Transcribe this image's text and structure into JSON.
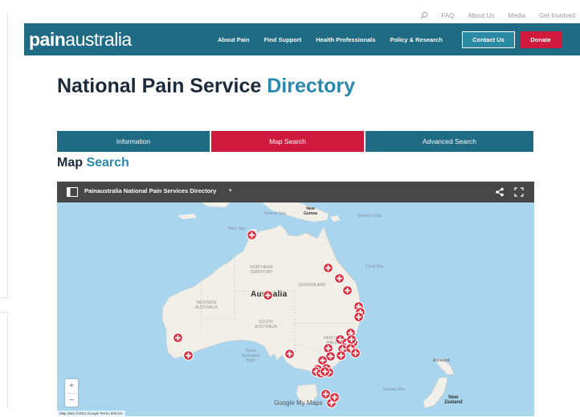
{
  "utility_nav": {
    "links": [
      "FAQ",
      "About Us",
      "Media",
      "Get Involved"
    ]
  },
  "header": {
    "logo": {
      "bold": "pain",
      "light": "australia"
    },
    "nav": [
      "About Pain",
      "Find Support",
      "Health Professionals",
      "Policy & Research"
    ],
    "contact_label": "Contact Us",
    "donate_label": "Donate"
  },
  "page": {
    "title_main": "National Pain Service",
    "title_accent": "Directory"
  },
  "tabs": [
    {
      "label": "Information",
      "active": false
    },
    {
      "label": "Map Search",
      "active": true
    },
    {
      "label": "Advanced Search",
      "active": false
    }
  ],
  "section": {
    "title_main": "Map",
    "title_accent": "Search"
  },
  "map": {
    "title": "Painaustralia National Pain Services Directory",
    "zoom_in": "+",
    "zoom_out": "−",
    "google_label": "Google My Maps",
    "attribution": "Map data ©2021 Google   Terms   500 km",
    "labels": {
      "new_guinea": "New\nGuinea",
      "arafura": "Arafura Sea",
      "solomon": "Solomon Sea",
      "timor": "Timor Sea",
      "coral": "Coral Sea",
      "nt": "NORTHERN\nTERRITORY",
      "qld": "QUEENSLAND",
      "wa": "WESTERN\nAUSTRALIA",
      "australia": "Australia",
      "sa": "SOUTH\nAUSTRALIA",
      "nsw": "NEW SO\nWALE",
      "bight": "Great\nAustralian\nBight",
      "auckland": "Auckland",
      "tasman": "Tasman Sea",
      "nz": "New\nZealand"
    }
  },
  "colors": {
    "navy": "#1f6b83",
    "red": "#cf1a3d",
    "accent_blue": "#2a87ad",
    "ocean": "#a9d5ef",
    "land": "#f2efe8",
    "marker": "#d8283a"
  }
}
